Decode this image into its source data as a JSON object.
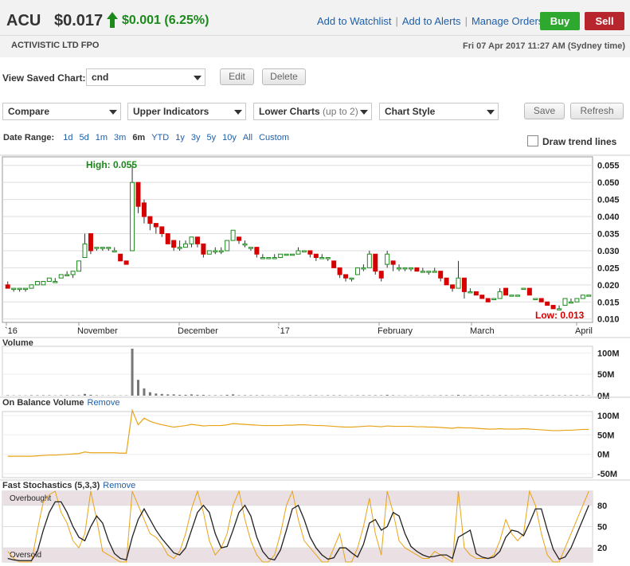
{
  "header": {
    "ticker": "ACU",
    "price": "$0.017",
    "change": "$0.001 (6.25%)",
    "links": [
      "Add to Watchlist",
      "Add to Alerts",
      "Manage Orders"
    ],
    "buy_label": "Buy",
    "sell_label": "Sell",
    "company": "ACTIVISTIC LTD FPO",
    "datetime": "Fri 07 Apr 2017 11:27 AM (Sydney time)"
  },
  "saved_chart": {
    "label": "View Saved Chart:",
    "value": "cnd",
    "edit_label": "Edit",
    "delete_label": "Delete"
  },
  "toolbar": {
    "compare": "Compare",
    "upper": "Upper Indicators",
    "lower": "Lower Charts",
    "lower_hint": "(up to 2)",
    "style": "Chart Style",
    "save_label": "Save",
    "refresh_label": "Refresh"
  },
  "date_range": {
    "label": "Date Range:",
    "options": [
      "1d",
      "5d",
      "1m",
      "3m",
      "6m",
      "YTD",
      "1y",
      "3y",
      "5y",
      "10y",
      "All",
      "Custom"
    ],
    "selected": "6m"
  },
  "trend_lines_label": "Draw trend lines",
  "colors": {
    "up": "#1b8a1b",
    "down": "#d60000",
    "obv": "#e8a317",
    "link": "#1f5fa8"
  },
  "chart_data": [
    {
      "type": "candlestick",
      "title": "",
      "high_label": "High: 0.055",
      "low_label": "Low: 0.013",
      "yticks": [
        "0.055",
        "0.050",
        "0.045",
        "0.040",
        "0.035",
        "0.030",
        "0.025",
        "0.020",
        "0.015",
        "0.010"
      ],
      "ylim": [
        0.009,
        0.0575
      ],
      "xticks": [
        "`16",
        "November",
        "December",
        "`17",
        "February",
        "March",
        "April"
      ],
      "candles": [
        [
          0.02,
          0.019,
          0.021,
          0.019
        ],
        [
          0.019,
          0.019,
          0.019,
          0.018
        ],
        [
          0.019,
          0.019,
          0.019,
          0.018
        ],
        [
          0.019,
          0.019,
          0.019,
          0.018
        ],
        [
          0.019,
          0.02,
          0.02,
          0.019
        ],
        [
          0.02,
          0.021,
          0.021,
          0.02
        ],
        [
          0.02,
          0.021,
          0.021,
          0.02
        ],
        [
          0.021,
          0.022,
          0.022,
          0.021
        ],
        [
          0.021,
          0.021,
          0.022,
          0.021
        ],
        [
          0.022,
          0.023,
          0.023,
          0.022
        ],
        [
          0.023,
          0.023,
          0.024,
          0.023
        ],
        [
          0.023,
          0.024,
          0.024,
          0.022
        ],
        [
          0.024,
          0.027,
          0.027,
          0.024
        ],
        [
          0.028,
          0.032,
          0.035,
          0.028
        ],
        [
          0.035,
          0.03,
          0.035,
          0.029
        ],
        [
          0.031,
          0.031,
          0.031,
          0.03
        ],
        [
          0.031,
          0.031,
          0.031,
          0.03
        ],
        [
          0.031,
          0.031,
          0.031,
          0.03
        ],
        [
          0.03,
          0.03,
          0.031,
          0.03
        ],
        [
          0.029,
          0.027,
          0.029,
          0.027
        ],
        [
          0.027,
          0.026,
          0.027,
          0.026
        ],
        [
          0.03,
          0.05,
          0.055,
          0.03
        ],
        [
          0.05,
          0.043,
          0.05,
          0.041
        ],
        [
          0.044,
          0.04,
          0.045,
          0.038
        ],
        [
          0.04,
          0.038,
          0.04,
          0.036
        ],
        [
          0.038,
          0.037,
          0.038,
          0.035
        ],
        [
          0.037,
          0.035,
          0.037,
          0.034
        ],
        [
          0.035,
          0.032,
          0.035,
          0.032
        ],
        [
          0.033,
          0.031,
          0.033,
          0.03
        ],
        [
          0.031,
          0.031,
          0.033,
          0.03
        ],
        [
          0.031,
          0.032,
          0.033,
          0.031
        ],
        [
          0.032,
          0.034,
          0.034,
          0.031
        ],
        [
          0.034,
          0.032,
          0.034,
          0.031
        ],
        [
          0.032,
          0.029,
          0.032,
          0.028
        ],
        [
          0.029,
          0.03,
          0.03,
          0.029
        ],
        [
          0.03,
          0.03,
          0.031,
          0.029
        ],
        [
          0.03,
          0.03,
          0.031,
          0.029
        ],
        [
          0.03,
          0.033,
          0.033,
          0.03
        ],
        [
          0.033,
          0.036,
          0.036,
          0.033
        ],
        [
          0.034,
          0.033,
          0.034,
          0.032
        ],
        [
          0.032,
          0.032,
          0.033,
          0.031
        ],
        [
          0.031,
          0.031,
          0.031,
          0.03
        ],
        [
          0.031,
          0.029,
          0.031,
          0.028
        ],
        [
          0.028,
          0.028,
          0.029,
          0.028
        ],
        [
          0.028,
          0.028,
          0.028,
          0.028
        ],
        [
          0.028,
          0.028,
          0.029,
          0.028
        ],
        [
          0.028,
          0.029,
          0.029,
          0.028
        ],
        [
          0.029,
          0.029,
          0.029,
          0.029
        ],
        [
          0.029,
          0.029,
          0.029,
          0.029
        ],
        [
          0.029,
          0.03,
          0.031,
          0.029
        ],
        [
          0.03,
          0.03,
          0.03,
          0.03
        ],
        [
          0.03,
          0.029,
          0.03,
          0.028
        ],
        [
          0.029,
          0.028,
          0.029,
          0.027
        ],
        [
          0.028,
          0.028,
          0.029,
          0.028
        ],
        [
          0.028,
          0.028,
          0.028,
          0.027
        ],
        [
          0.027,
          0.025,
          0.027,
          0.025
        ],
        [
          0.025,
          0.023,
          0.025,
          0.022
        ],
        [
          0.023,
          0.022,
          0.023,
          0.021
        ],
        [
          0.022,
          0.022,
          0.022,
          0.021
        ],
        [
          0.023,
          0.025,
          0.025,
          0.023
        ],
        [
          0.025,
          0.025,
          0.026,
          0.024
        ],
        [
          0.025,
          0.029,
          0.03,
          0.025
        ],
        [
          0.029,
          0.024,
          0.029,
          0.023
        ],
        [
          0.024,
          0.022,
          0.024,
          0.021
        ],
        [
          0.026,
          0.029,
          0.03,
          0.025
        ],
        [
          0.027,
          0.026,
          0.027,
          0.024
        ],
        [
          0.025,
          0.025,
          0.026,
          0.024
        ],
        [
          0.025,
          0.025,
          0.025,
          0.024
        ],
        [
          0.025,
          0.025,
          0.025,
          0.024
        ],
        [
          0.025,
          0.024,
          0.025,
          0.024
        ],
        [
          0.024,
          0.024,
          0.025,
          0.024
        ],
        [
          0.024,
          0.024,
          0.024,
          0.023
        ],
        [
          0.024,
          0.024,
          0.025,
          0.024
        ],
        [
          0.024,
          0.022,
          0.024,
          0.021
        ],
        [
          0.022,
          0.02,
          0.022,
          0.02
        ],
        [
          0.02,
          0.019,
          0.02,
          0.018
        ],
        [
          0.019,
          0.022,
          0.027,
          0.019
        ],
        [
          0.022,
          0.018,
          0.022,
          0.016
        ],
        [
          0.018,
          0.018,
          0.019,
          0.018
        ],
        [
          0.018,
          0.017,
          0.018,
          0.017
        ],
        [
          0.017,
          0.016,
          0.017,
          0.016
        ],
        [
          0.016,
          0.015,
          0.016,
          0.015
        ],
        [
          0.016,
          0.016,
          0.016,
          0.016
        ],
        [
          0.016,
          0.018,
          0.019,
          0.016
        ],
        [
          0.019,
          0.017,
          0.019,
          0.017
        ],
        [
          0.017,
          0.017,
          0.017,
          0.017
        ],
        [
          0.017,
          0.017,
          0.017,
          0.017
        ],
        [
          0.019,
          0.019,
          0.019,
          0.019
        ],
        [
          0.019,
          0.017,
          0.019,
          0.017
        ],
        [
          0.016,
          0.016,
          0.016,
          0.016
        ],
        [
          0.016,
          0.015,
          0.016,
          0.015
        ],
        [
          0.015,
          0.014,
          0.015,
          0.014
        ],
        [
          0.014,
          0.013,
          0.014,
          0.013
        ],
        [
          0.013,
          0.013,
          0.014,
          0.013
        ],
        [
          0.014,
          0.016,
          0.016,
          0.014
        ],
        [
          0.015,
          0.015,
          0.016,
          0.015
        ],
        [
          0.015,
          0.016,
          0.016,
          0.015
        ],
        [
          0.016,
          0.017,
          0.017,
          0.016
        ],
        [
          0.017,
          0.017,
          0.017,
          0.017
        ]
      ]
    },
    {
      "type": "bar",
      "title": "Volume",
      "yticks": [
        "100M",
        "50M",
        "0M"
      ],
      "ylim": [
        0,
        110
      ],
      "values": [
        1,
        0.5,
        0.5,
        0.5,
        1,
        1,
        1,
        1,
        0.5,
        1,
        1,
        1,
        1,
        4,
        2,
        1,
        0.5,
        0.5,
        0.5,
        0.5,
        0.5,
        110,
        37,
        17,
        8,
        5,
        4,
        3,
        3,
        2,
        2,
        3,
        2,
        2,
        1,
        1,
        1,
        2,
        3,
        1,
        1,
        1,
        1,
        1,
        0.5,
        0.5,
        0.5,
        1,
        0.5,
        1,
        0.5,
        1,
        1,
        0.5,
        1,
        1,
        1,
        0.5,
        0.5,
        1,
        1,
        1,
        1,
        1,
        2,
        1,
        0.5,
        0.5,
        0.5,
        0.5,
        0.5,
        0.5,
        0.5,
        1,
        1,
        1,
        2,
        1,
        1,
        0.5,
        1,
        1,
        0.5,
        1,
        1,
        0.5,
        0.5,
        0.5,
        0.5,
        1,
        1,
        1,
        1,
        1,
        1,
        1,
        1,
        1,
        0.5
      ]
    },
    {
      "type": "line",
      "title": "On Balance Volume",
      "remove_label": "Remove",
      "yticks": [
        "100M",
        "50M",
        "0M",
        "-50M"
      ],
      "ylim": [
        -60,
        110
      ],
      "values": [
        -5,
        -5,
        -5,
        -5,
        -5,
        -4,
        -3,
        -2,
        -2,
        -1,
        0,
        1,
        2,
        6,
        4,
        4,
        4,
        4,
        4,
        3,
        3,
        113,
        76,
        93,
        85,
        80,
        76,
        73,
        70,
        72,
        74,
        77,
        75,
        73,
        74,
        74,
        74,
        76,
        79,
        78,
        77,
        76,
        75,
        74,
        74,
        74,
        74,
        75,
        75,
        76,
        76,
        75,
        74,
        74,
        73,
        72,
        71,
        70,
        70,
        71,
        72,
        73,
        72,
        71,
        73,
        72,
        72,
        72,
        72,
        71,
        71,
        70,
        70,
        69,
        68,
        67,
        69,
        68,
        68,
        67,
        66,
        65,
        65,
        66,
        65,
        65,
        65,
        66,
        65,
        64,
        63,
        62,
        61,
        61,
        62,
        62,
        63,
        64,
        64
      ]
    },
    {
      "type": "line",
      "title": "Fast Stochastics (5,3,3)",
      "remove_label": "Remove",
      "yticks": [
        "80",
        "50",
        "20"
      ],
      "ylim": [
        0,
        100
      ],
      "overbought_label": "Overbought",
      "oversold_label": "Oversold",
      "series": [
        {
          "values": [
            15,
            5,
            0,
            0,
            0,
            45,
            85,
            95,
            100,
            70,
            55,
            30,
            20,
            40,
            100,
            60,
            15,
            10,
            5,
            0,
            0,
            100,
            80,
            60,
            40,
            35,
            25,
            10,
            5,
            15,
            40,
            75,
            100,
            70,
            30,
            10,
            20,
            40,
            80,
            100,
            60,
            30,
            10,
            0,
            0,
            10,
            40,
            80,
            100,
            60,
            30,
            20,
            10,
            0,
            0,
            20,
            40,
            0,
            0,
            20,
            50,
            90,
            40,
            10,
            100,
            70,
            30,
            20,
            15,
            10,
            5,
            5,
            15,
            10,
            5,
            0,
            100,
            20,
            10,
            5,
            5,
            5,
            10,
            30,
            60,
            40,
            30,
            40,
            100,
            80,
            40,
            10,
            0,
            0,
            20,
            40,
            60,
            80,
            100
          ]
        },
        {
          "values": [
            5,
            3,
            2,
            2,
            2,
            15,
            45,
            70,
            85,
            85,
            70,
            50,
            35,
            30,
            50,
            65,
            55,
            30,
            12,
            5,
            3,
            35,
            60,
            75,
            60,
            45,
            33,
            23,
            13,
            10,
            20,
            45,
            70,
            80,
            70,
            40,
            20,
            22,
            45,
            70,
            80,
            65,
            35,
            15,
            5,
            3,
            17,
            45,
            75,
            80,
            60,
            35,
            20,
            10,
            4,
            6,
            20,
            20,
            13,
            7,
            25,
            55,
            60,
            45,
            50,
            70,
            65,
            40,
            22,
            15,
            10,
            7,
            8,
            10,
            10,
            5,
            35,
            40,
            45,
            12,
            7,
            5,
            7,
            15,
            35,
            45,
            43,
            37,
            55,
            75,
            75,
            45,
            18,
            4,
            7,
            20,
            40,
            60,
            80
          ]
        }
      ]
    }
  ]
}
